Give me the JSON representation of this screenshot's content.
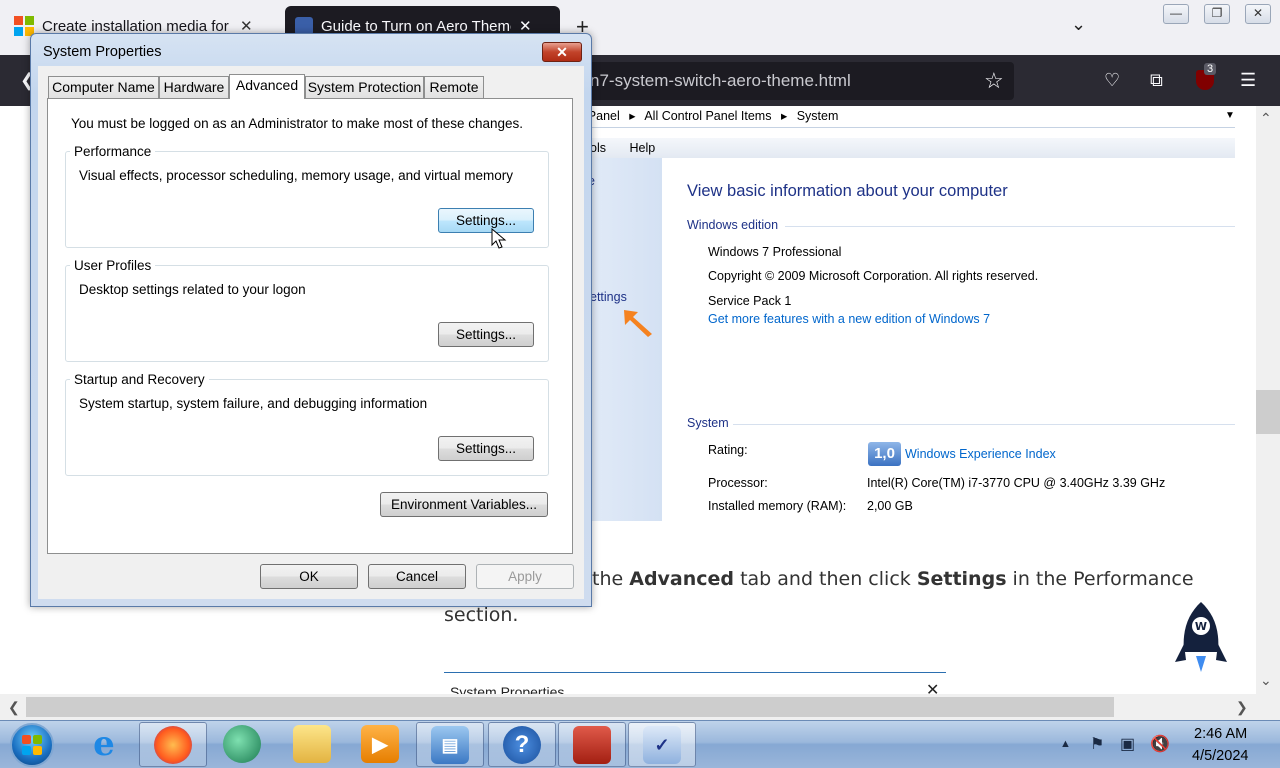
{
  "browser": {
    "tabs": [
      {
        "title": "Create installation media for W",
        "close": "✕"
      },
      {
        "title": "Guide to Turn on Aero Theme o",
        "close": "✕"
      }
    ],
    "new_tab": "+",
    "tab_list": "⌄",
    "url_text": "n7-system-switch-aero-theme.html",
    "ublock_badge": "3",
    "window_controls": {
      "minimize": "—",
      "restore": "❐",
      "close": "✕"
    }
  },
  "control_panel_shot": {
    "breadcrumb": [
      "ntrol Panel",
      "▸",
      "All Control Panel Items",
      "▸",
      "System"
    ],
    "menu": [
      "ols",
      "Help"
    ],
    "left_link": "ettings",
    "main_title": "View basic information about your computer",
    "windows_edition_label": "Windows edition",
    "edition": "Windows 7 Professional",
    "copyright": "Copyright © 2009 Microsoft Corporation.  All rights reserved.",
    "service_pack": "Service Pack 1",
    "more_features_link": "Get more features with a new edition of Windows 7",
    "system_label": "System",
    "rating_label": "Rating:",
    "wei_score": "1,0",
    "wei_link": "Windows Experience Index",
    "processor_label": "Processor:",
    "processor_value": "Intel(R) Core(TM) i7-3770 CPU @ 3.40GHz   3.39 GHz",
    "ram_label": "Installed memory (RAM):",
    "ram_value": "2,00 GB",
    "left_fragment": "e"
  },
  "article": {
    "line1_pre": "the ",
    "line1_b1": "Advanced",
    "line1_mid": " tab and then click ",
    "line1_b2": "Settings",
    "line1_post": " in the Performance",
    "line2": "section.",
    "next_shot_title": "System Properties",
    "next_shot_close": "✕"
  },
  "dialog": {
    "title": "System Properties",
    "close": "✕",
    "tabs": [
      "Computer Name",
      "Hardware",
      "Advanced",
      "System Protection",
      "Remote"
    ],
    "active_tab": "Advanced",
    "admin_note": "You must be logged on as an Administrator to make most of these changes.",
    "performance": {
      "label": "Performance",
      "desc": "Visual effects, processor scheduling, memory usage, and virtual memory",
      "button": "Settings..."
    },
    "user_profiles": {
      "label": "User Profiles",
      "desc": "Desktop settings related to your logon",
      "button": "Settings..."
    },
    "startup_recovery": {
      "label": "Startup and Recovery",
      "desc": "System startup, system failure, and debugging information",
      "button": "Settings..."
    },
    "env_vars": "Environment Variables...",
    "ok": "OK",
    "cancel": "Cancel",
    "apply": "Apply"
  },
  "taskbar": {
    "time": "2:46 AM",
    "date": "4/5/2024"
  },
  "colors": {
    "link": "#0066cc",
    "cp_heading": "#1e3287",
    "close_red": "#c2432a",
    "arrow_orange": "#f5821f"
  }
}
